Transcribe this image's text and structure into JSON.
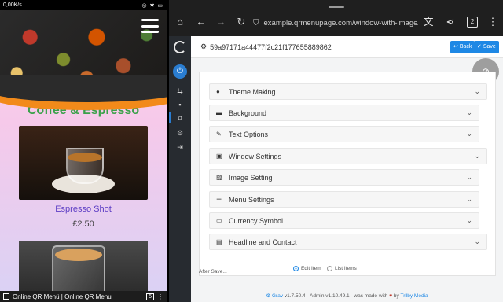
{
  "status_bar": {
    "speed": "0,00K/s",
    "icons": "◎ ✱ ▭"
  },
  "menu_preview": {
    "category_title": "Coffee & Espresso",
    "item_name": "Espresso Shot",
    "item_price": "£2.50",
    "bottom_tab_title": "Online QR Menü | Online QR Menu",
    "bottom_tab_count": "5",
    "accent_green": "#3aa14a",
    "item_name_color": "#5b3cc4"
  },
  "browser": {
    "url": "example.qrmenupage.com/window-with-image/b…",
    "tab_count": "2",
    "icons": [
      "home-icon",
      "back-icon",
      "forward-icon",
      "reload-icon",
      "site-info-icon",
      "translate-icon",
      "share-icon",
      "tabs-icon",
      "more-icon"
    ]
  },
  "admin": {
    "page_id": "59a97171a44477f2c21f177655889862",
    "back_label": "Back",
    "save_label": "Save",
    "accordion": [
      {
        "label": "Theme Making",
        "icon": "flame-icon"
      },
      {
        "label": "Background",
        "icon": "card-icon"
      },
      {
        "label": "Text Options",
        "icon": "edit-icon"
      },
      {
        "label": "Window Settings",
        "icon": "window-image-icon"
      },
      {
        "label": "Image Setting",
        "icon": "image-icon"
      },
      {
        "label": "Menu Settings",
        "icon": "list-icon"
      },
      {
        "label": "Currency Symbol",
        "icon": "money-icon"
      },
      {
        "label": "Headline and Contact",
        "icon": "contact-card-icon"
      }
    ],
    "after_save_label": "After Save...",
    "radio_edit_label": "Edit Item",
    "radio_list_label": "List Items",
    "footer_grav": "Grav",
    "footer_version": "v1.7.50.4 - Admin v1.10.49.1 - was made with",
    "footer_by": "by",
    "footer_trilby": "Trilby Media",
    "accent_blue": "#1e88e5"
  }
}
